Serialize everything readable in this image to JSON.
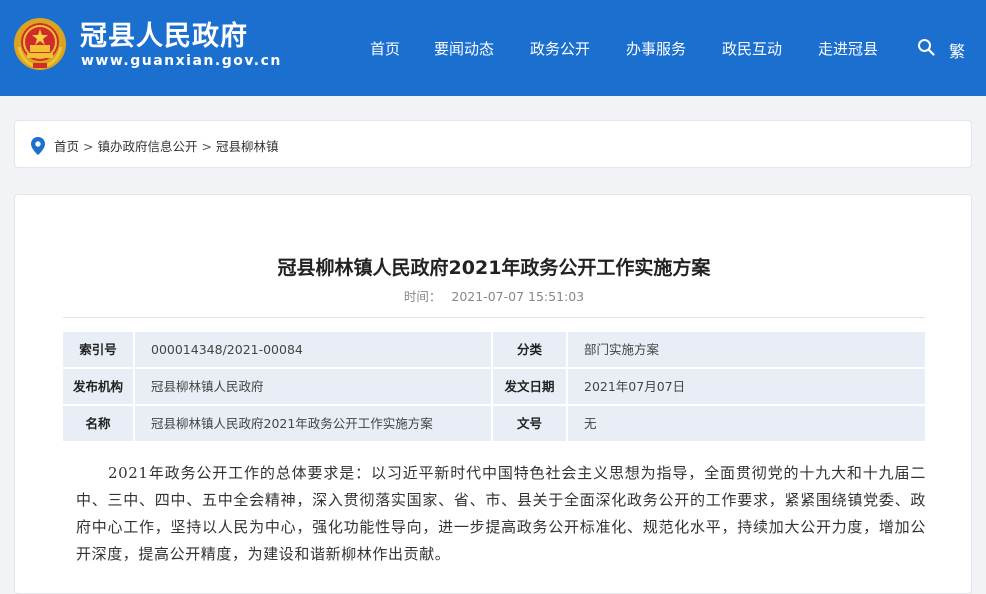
{
  "header": {
    "site_name": "冠县人民政府",
    "site_url": "www.guanxian.gov.cn",
    "nav": [
      "首页",
      "要闻动态",
      "政务公开",
      "办事服务",
      "政民互动",
      "走进冠县"
    ],
    "search_icon": "search-icon",
    "traditional_label": "繁",
    "brand_color": "#1a6fcf"
  },
  "breadcrumb": {
    "icon": "location-pin-icon",
    "items": [
      "首页",
      "镇办政府信息公开",
      "冠县柳林镇"
    ],
    "separator": ">"
  },
  "article": {
    "title": "冠县柳林镇人民政府2021年政务公开工作实施方案",
    "time_label": "时间：",
    "time_value": "2021-07-07 15:51:03",
    "meta": [
      {
        "k1": "索引号",
        "v1": "000014348/2021-00084",
        "k2": "分类",
        "v2": "部门实施方案"
      },
      {
        "k1": "发布机构",
        "v1": "冠县柳林镇人民政府",
        "k2": "发文日期",
        "v2": "2021年07月07日"
      },
      {
        "k1": "名称",
        "v1": "冠县柳林镇人民政府2021年政务公开工作实施方案",
        "k2": "文号",
        "v2": "无"
      }
    ],
    "body": "2021年政务公开工作的总体要求是：以习近平新时代中国特色社会主义思想为指导，全面贯彻党的十九大和十九届二中、三中、四中、五中全会精神，深入贯彻落实国家、省、市、县关于全面深化政务公开的工作要求，紧紧围绕镇党委、政府中心工作，坚持以人民为中心，强化功能性导向，进一步提高政务公开标准化、规范化水平，持续加大公开力度，增加公开深度，提高公开精度，为建设和谐新柳林作出贡献。"
  }
}
